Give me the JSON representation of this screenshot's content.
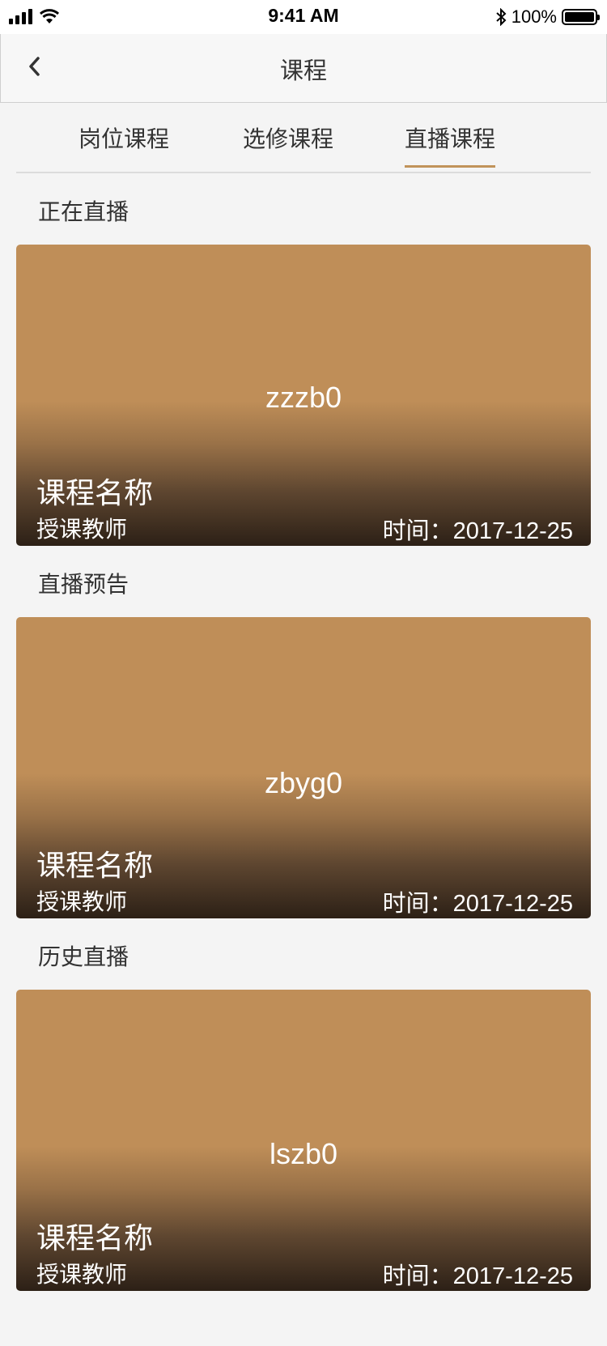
{
  "status_bar": {
    "time": "9:41 AM",
    "battery": "100%"
  },
  "nav": {
    "title": "课程"
  },
  "tabs": [
    {
      "label": "岗位课程"
    },
    {
      "label": "选修课程"
    },
    {
      "label": "直播课程"
    }
  ],
  "active_tab": "直播课程",
  "accent_color": "#c1935a",
  "sections": [
    {
      "title": "正在直播",
      "card": {
        "code": "zzzb0",
        "name": "课程名称",
        "teacher": "授课教师",
        "time": "时间：2017-12-25"
      }
    },
    {
      "title": "直播预告",
      "card": {
        "code": "zbyg0",
        "name": "课程名称",
        "teacher": "授课教师",
        "time": "时间：2017-12-25"
      }
    },
    {
      "title": "历史直播",
      "card": {
        "code": "lszb0",
        "name": "课程名称",
        "teacher": "授课教师",
        "time": "时间：2017-12-25"
      }
    }
  ]
}
